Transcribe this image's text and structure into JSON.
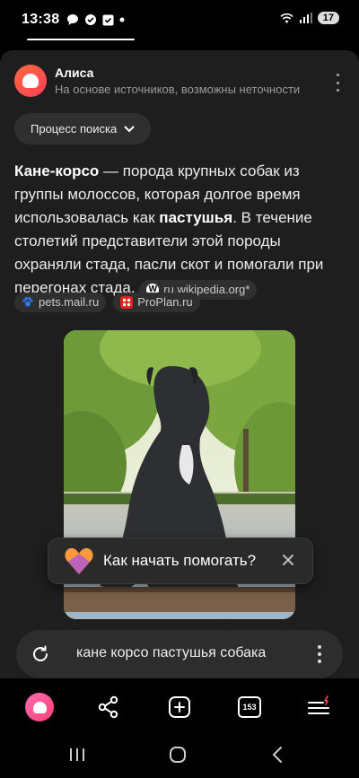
{
  "status_bar": {
    "time": "13:38",
    "battery": "17"
  },
  "assistant": {
    "name": "Алиса",
    "subtitle": "На основе источников, возможны неточности"
  },
  "search_process": {
    "label": "Процесс поиска"
  },
  "answer": {
    "term": "Кане-корсо",
    "part1": " — порода крупных собак из группы молоссов, которая долгое время использовалась как ",
    "highlight": "пастушья",
    "part2": ". В течение столетий представители этой породы охраняли стада, пасли скот и помогали при перегонах стада. "
  },
  "sources": [
    {
      "label": "ru.wikipedia.org*",
      "icon": "wikipedia-icon",
      "color": "#ffffff"
    },
    {
      "label": "pets.mail.ru",
      "icon": "mailru-pets-icon",
      "color": "#2f7cf6"
    },
    {
      "label": "ProPlan.ru",
      "icon": "proplan-icon",
      "color": "#e2231a"
    }
  ],
  "popup": {
    "label": "Как начать помогать?"
  },
  "search_bar": {
    "query": "кане корсо пастушья собака"
  },
  "toolbar": {
    "tabs_count": "153"
  },
  "colors": {
    "accent": "#ff4a4a",
    "background": "#000000",
    "card": "#1e1e1e"
  }
}
